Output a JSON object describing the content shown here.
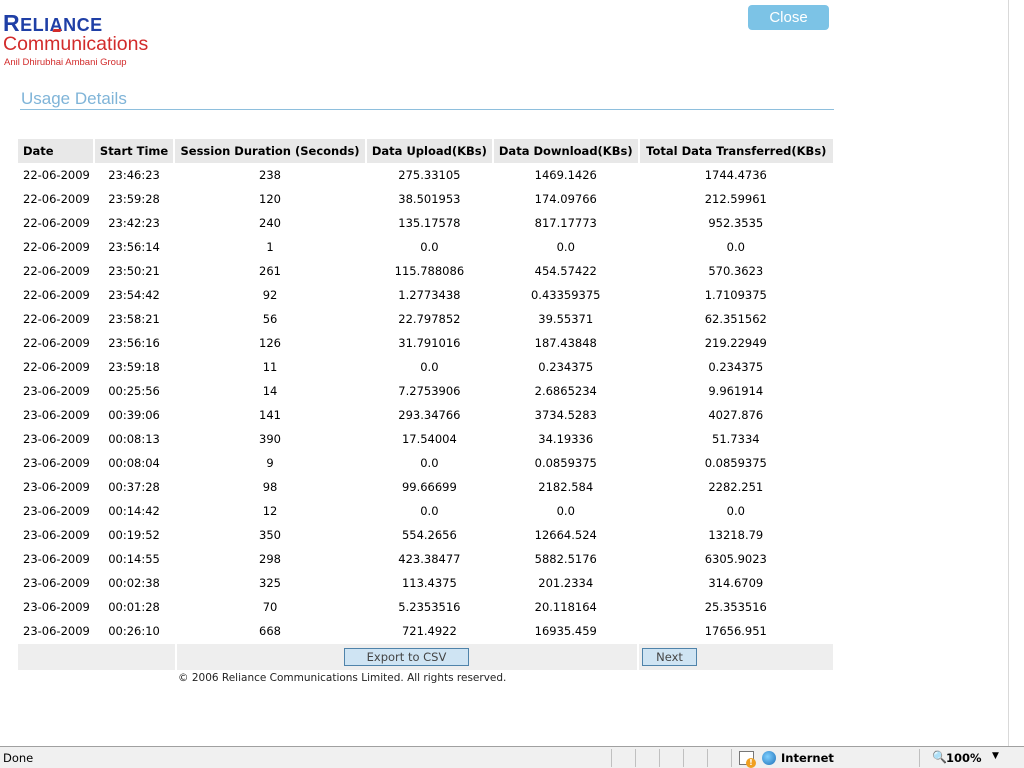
{
  "logo": {
    "brand_pre": "R",
    "brand_e": "E",
    "brand_li": "LI",
    "brand_a": "A",
    "brand_post": "NCE",
    "sub": "Communications",
    "group": "Anil Dhirubhai Ambani Group"
  },
  "close_label": "Close",
  "page_title": "Usage Details",
  "table": {
    "columns": [
      "Date",
      "Start Time",
      "Session Duration (Seconds)",
      "Data Upload(KBs)",
      "Data Download(KBs)",
      "Total Data Transferred(KBs)"
    ],
    "rows": [
      [
        "22-06-2009",
        "23:46:23",
        "238",
        "275.33105",
        "1469.1426",
        "1744.4736"
      ],
      [
        "22-06-2009",
        "23:59:28",
        "120",
        "38.501953",
        "174.09766",
        "212.59961"
      ],
      [
        "22-06-2009",
        "23:42:23",
        "240",
        "135.17578",
        "817.17773",
        "952.3535"
      ],
      [
        "22-06-2009",
        "23:56:14",
        "1",
        "0.0",
        "0.0",
        "0.0"
      ],
      [
        "22-06-2009",
        "23:50:21",
        "261",
        "115.788086",
        "454.57422",
        "570.3623"
      ],
      [
        "22-06-2009",
        "23:54:42",
        "92",
        "1.2773438",
        "0.43359375",
        "1.7109375"
      ],
      [
        "22-06-2009",
        "23:58:21",
        "56",
        "22.797852",
        "39.55371",
        "62.351562"
      ],
      [
        "22-06-2009",
        "23:56:16",
        "126",
        "31.791016",
        "187.43848",
        "219.22949"
      ],
      [
        "22-06-2009",
        "23:59:18",
        "11",
        "0.0",
        "0.234375",
        "0.234375"
      ],
      [
        "23-06-2009",
        "00:25:56",
        "14",
        "7.2753906",
        "2.6865234",
        "9.961914"
      ],
      [
        "23-06-2009",
        "00:39:06",
        "141",
        "293.34766",
        "3734.5283",
        "4027.876"
      ],
      [
        "23-06-2009",
        "00:08:13",
        "390",
        "17.54004",
        "34.19336",
        "51.7334"
      ],
      [
        "23-06-2009",
        "00:08:04",
        "9",
        "0.0",
        "0.0859375",
        "0.0859375"
      ],
      [
        "23-06-2009",
        "00:37:28",
        "98",
        "99.66699",
        "2182.584",
        "2282.251"
      ],
      [
        "23-06-2009",
        "00:14:42",
        "12",
        "0.0",
        "0.0",
        "0.0"
      ],
      [
        "23-06-2009",
        "00:19:52",
        "350",
        "554.2656",
        "12664.524",
        "13218.79"
      ],
      [
        "23-06-2009",
        "00:14:55",
        "298",
        "423.38477",
        "5882.5176",
        "6305.9023"
      ],
      [
        "23-06-2009",
        "00:02:38",
        "325",
        "113.4375",
        "201.2334",
        "314.6709"
      ],
      [
        "23-06-2009",
        "00:01:28",
        "70",
        "5.2353516",
        "20.118164",
        "25.353516"
      ],
      [
        "23-06-2009",
        "00:26:10",
        "668",
        "721.4922",
        "16935.459",
        "17656.951"
      ]
    ]
  },
  "export_label": "Export to CSV",
  "next_label": "Next",
  "copyright": "© 2006 Reliance Communications Limited. All rights reserved.",
  "statusbar": {
    "status": "Done",
    "zone": "Internet",
    "zoom": "100%",
    "icons": [
      "protected-mode-icon",
      "globe-icon",
      "zoom-icon"
    ]
  },
  "colors": {
    "brand_blue": "#1f3fa6",
    "brand_red": "#d22b2b",
    "close_bg": "#7cc3e6",
    "title_blue": "#7fb4d8"
  }
}
